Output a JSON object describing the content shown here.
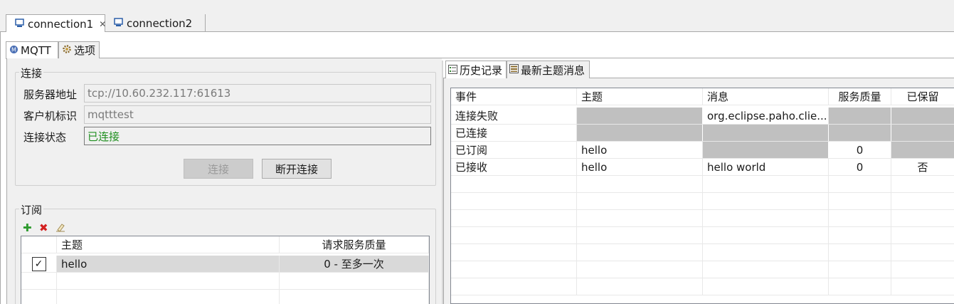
{
  "connection_tabs": [
    {
      "label": "connection1",
      "active": true,
      "closable": true
    },
    {
      "label": "connection2",
      "active": false,
      "closable": false
    }
  ],
  "inner_tabs": [
    {
      "label": "MQTT",
      "icon": "mqtt-icon"
    },
    {
      "label": "选项",
      "icon": "gear-icon"
    }
  ],
  "connection": {
    "title": "连接",
    "server_label": "服务器地址",
    "server_value": "tcp://10.60.232.117:61613",
    "client_label": "客户机标识",
    "client_value": "mqtttest",
    "status_label": "连接状态",
    "status_value": "已连接",
    "connect_button": "连接",
    "disconnect_button": "断开连接"
  },
  "subscribe": {
    "title": "订阅",
    "toolbar": {
      "add_icon": "plus-icon",
      "delete_icon": "x-icon",
      "edit_icon": "eraser-icon"
    },
    "columns": [
      "主题",
      "请求服务质量"
    ],
    "rows": [
      {
        "checked": true,
        "topic": "hello",
        "qos": "0 - 至多一次"
      }
    ]
  },
  "right_tabs": [
    {
      "label": "历史记录",
      "icon": "history-list-icon"
    },
    {
      "label": "最新主题消息",
      "icon": "latest-messages-icon"
    }
  ],
  "history": {
    "columns": [
      "事件",
      "主题",
      "消息",
      "服务质量",
      "已保留"
    ],
    "rows": [
      {
        "event": "连接失败",
        "topic": "",
        "message": "org.eclipse.paho.clie...",
        "qos": "",
        "retained": "",
        "gray": [
          false,
          true,
          false,
          true,
          true
        ]
      },
      {
        "event": "已连接",
        "topic": "",
        "message": "",
        "qos": "",
        "retained": "",
        "gray": [
          false,
          true,
          true,
          true,
          true
        ]
      },
      {
        "event": "已订阅",
        "topic": "hello",
        "message": "",
        "qos": "0",
        "retained": "",
        "gray": [
          false,
          false,
          true,
          false,
          true
        ]
      },
      {
        "event": "已接收",
        "topic": "hello",
        "message": "hello world",
        "qos": "0",
        "retained": "否",
        "gray": [
          false,
          false,
          false,
          false,
          false
        ]
      }
    ]
  },
  "colors": {
    "status_green": "#1f8f1f",
    "gray_cell": "#c0c0c0",
    "selected_row": "#d9d9d9"
  }
}
